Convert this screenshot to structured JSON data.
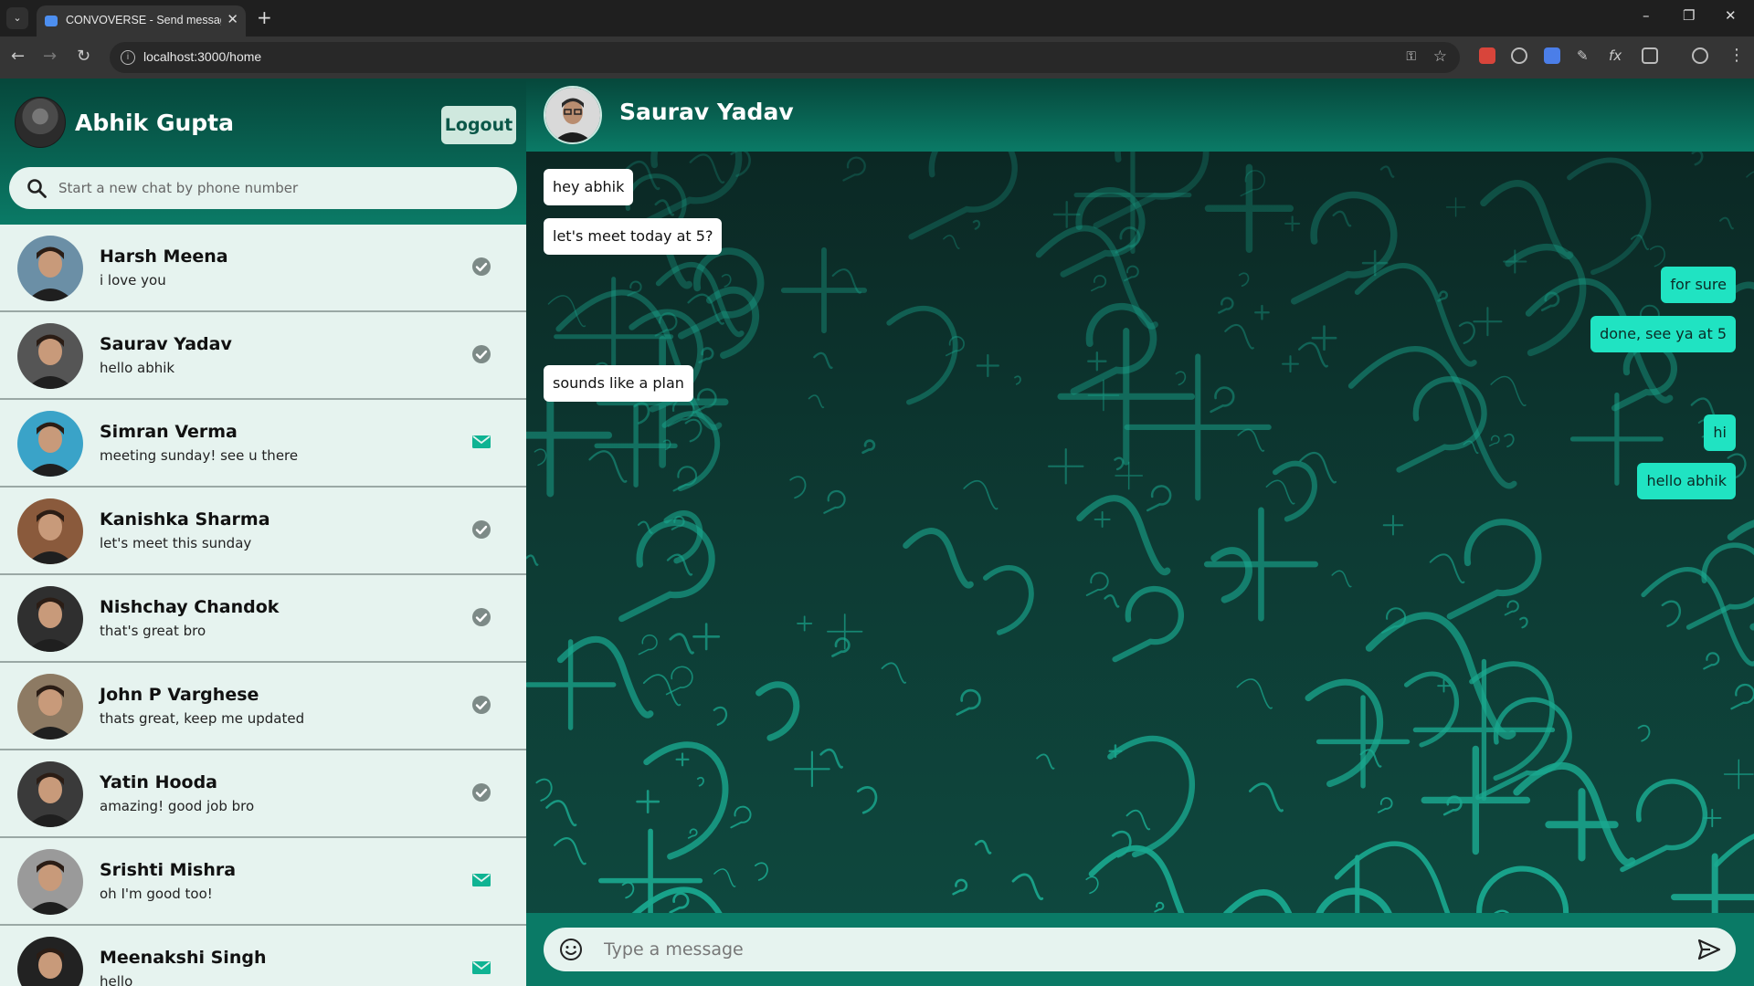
{
  "browser": {
    "tab_title": "CONVOVERSE - Send messages",
    "url": "localhost:3000/home"
  },
  "sidebar": {
    "user_name": "Abhik Gupta",
    "logout_label": "Logout",
    "search_placeholder": "Start a new chat by phone number",
    "chats": [
      {
        "name": "Harsh Meena",
        "last_message": "i love you",
        "status": "read",
        "avatar_color": "#6b8fa6"
      },
      {
        "name": "Saurav Yadav",
        "last_message": "hello abhik",
        "status": "read",
        "avatar_color": "#555555"
      },
      {
        "name": "Simran Verma",
        "last_message": "meeting sunday! see u there",
        "status": "unread",
        "avatar_color": "#3aa3c8"
      },
      {
        "name": "Kanishka Sharma",
        "last_message": "let's meet this sunday",
        "status": "read",
        "avatar_color": "#8a5a3c"
      },
      {
        "name": "Nishchay Chandok",
        "last_message": "that's great bro",
        "status": "read",
        "avatar_color": "#2f2f2f"
      },
      {
        "name": "John P Varghese",
        "last_message": "thats great, keep me updated",
        "status": "read",
        "avatar_color": "#8d7a63"
      },
      {
        "name": "Yatin Hooda",
        "last_message": "amazing! good job bro",
        "status": "read",
        "avatar_color": "#3a3a3a"
      },
      {
        "name": "Srishti Mishra",
        "last_message": "oh I'm good too!",
        "status": "unread",
        "avatar_color": "#9a9a9a"
      },
      {
        "name": "Meenakshi Singh",
        "last_message": "hello",
        "status": "unread",
        "avatar_color": "#222222"
      }
    ]
  },
  "chat": {
    "peer_name": "Saurav Yadav",
    "messages": [
      {
        "text": "hey abhik",
        "direction": "in"
      },
      {
        "text": "let's meet today at 5?",
        "direction": "in"
      },
      {
        "text": "for sure",
        "direction": "out"
      },
      {
        "text": "done, see ya at 5",
        "direction": "out"
      },
      {
        "text": "sounds like a plan",
        "direction": "in"
      },
      {
        "text": "hi",
        "direction": "out"
      },
      {
        "text": "hello abhik",
        "direction": "out"
      }
    ],
    "input_placeholder": "Type a message"
  },
  "colors": {
    "header_dark": "#06473b",
    "header_light": "#0a7a66",
    "outgoing_bubble": "#20e3c2",
    "list_bg": "#e6f3ef",
    "status_read": "#7d8a87",
    "status_unread": "#0fb393"
  }
}
